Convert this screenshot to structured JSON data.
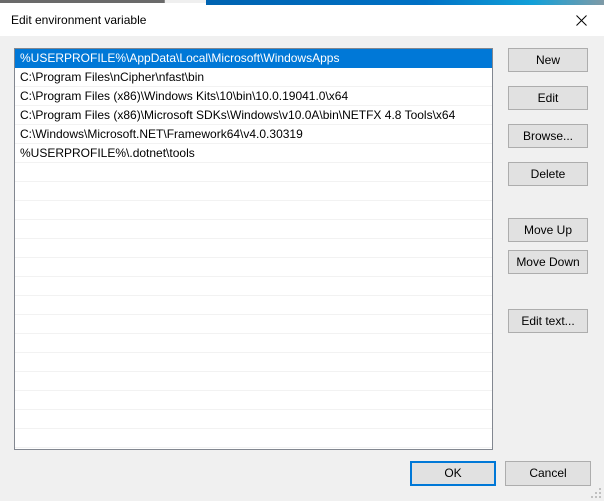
{
  "window": {
    "title": "Edit environment variable",
    "close_icon": "close-icon",
    "accent_color": "#0078d7",
    "background_color": "#f0f0f0",
    "button_face_color": "#e1e1e1"
  },
  "background_window": {
    "titlebar_color": "#0063b1"
  },
  "path_list": {
    "selected_index": 0,
    "total_visible_rows": 21,
    "entries": [
      "%USERPROFILE%\\AppData\\Local\\Microsoft\\WindowsApps",
      "C:\\Program Files\\nCipher\\nfast\\bin",
      "C:\\Program Files (x86)\\Windows Kits\\10\\bin\\10.0.19041.0\\x64",
      "C:\\Program Files (x86)\\Microsoft SDKs\\Windows\\v10.0A\\bin\\NETFX 4.8 Tools\\x64",
      "C:\\Windows\\Microsoft.NET\\Framework64\\v4.0.30319",
      "%USERPROFILE%\\.dotnet\\tools"
    ]
  },
  "side_buttons": {
    "new": "New",
    "edit": "Edit",
    "browse": "Browse...",
    "delete": "Delete",
    "move_up": "Move Up",
    "move_down": "Move Down",
    "edit_text": "Edit text..."
  },
  "footer_buttons": {
    "ok": "OK",
    "cancel": "Cancel"
  }
}
